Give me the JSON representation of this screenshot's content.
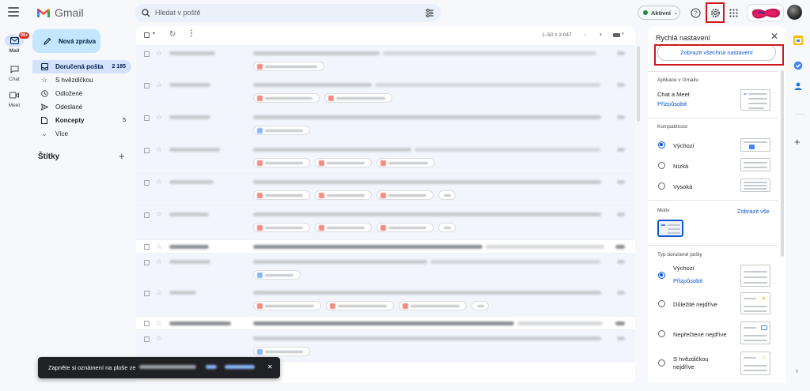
{
  "header": {
    "app_name": "Gmail",
    "search_placeholder": "Hledat v poště",
    "status_label": "Aktivní"
  },
  "rail": {
    "mail": {
      "label": "Mail",
      "badge": "99+"
    },
    "chat": {
      "label": "Chat"
    },
    "meet": {
      "label": "Meet"
    }
  },
  "sidebar": {
    "compose_label": "Nová zpráva",
    "items": [
      {
        "label": "Doručená pošta",
        "count": "2 185",
        "icon": "inbox-icon"
      },
      {
        "label": "S hvězdičkou",
        "count": "",
        "icon": "star-icon"
      },
      {
        "label": "Odložené",
        "count": "",
        "icon": "clock-icon"
      },
      {
        "label": "Odeslané",
        "count": "",
        "icon": "send-icon"
      },
      {
        "label": "Koncepty",
        "count": "5",
        "icon": "draft-icon"
      },
      {
        "label": "Více",
        "count": "",
        "icon": "chevron-down-icon"
      }
    ],
    "labels_heading": "Štítky"
  },
  "mail_list": {
    "pagination": "1–50 z 3 047",
    "visible_sender": "Justin Kresjes",
    "visible_subject": "PR: The United Series Could Look Into Future Global Technology Book to Drive",
    "visible_sender_2": "Wojtech Frank Kosko",
    "visible_subject_2": "[TIP] • Samsung Galaxy S24 Ultra Spotted on 3C Certification with Satellite Connectivity Support"
  },
  "toast": {
    "text": "Zapněte si oznámení na ploše ze",
    "action_ok": "OK",
    "action_no": "Ne, děkuji"
  },
  "quick_settings": {
    "title": "Rychlá nastavení",
    "all_settings_button": "Zobrazit všechna nastavení",
    "apps_heading": "Aplikace v Gmailu",
    "apps_value": "Chat a Meet",
    "apps_customize": "Přizpůsobit",
    "density_heading": "Kompaktnost",
    "density_options": [
      "Výchozí",
      "Nízká",
      "Vysoká"
    ],
    "density_selected": "Výchozí",
    "theme_heading": "Motiv",
    "theme_view_all": "Zobrazit vše",
    "inbox_type_heading": "Typ doručené pošty",
    "inbox_options": [
      "Výchozí",
      "Důležité nejdříve",
      "Nepřečtené nejdříve",
      "S hvězdičkou nejdříve"
    ],
    "inbox_default_customize": "Přizpůsobit",
    "inbox_selected": "Výchozí"
  },
  "colors": {
    "highlight_red": "#d0151b",
    "link_blue": "#0b57d0",
    "compose_bg": "#c2e7ff",
    "active_nav_bg": "#d3e3fd"
  }
}
